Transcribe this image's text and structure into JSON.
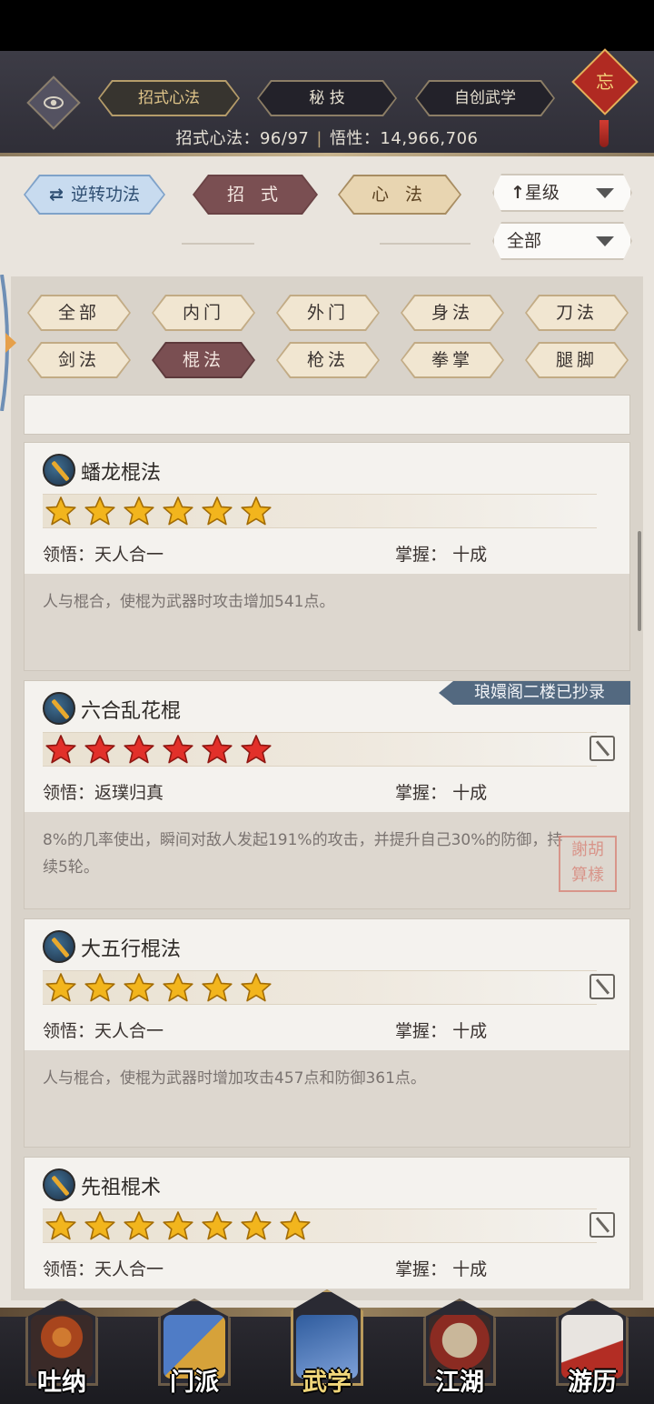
{
  "header": {
    "tabs": [
      {
        "label": "招式心法",
        "active": true
      },
      {
        "label": "秘 技",
        "active": false
      },
      {
        "label": "自创武学",
        "active": false
      }
    ],
    "stats_left": "招式心法：96/97",
    "stats_sep": "|",
    "stats_right": "悟性：14,966,706",
    "knot_char": "忘"
  },
  "toolbar": {
    "reverse_label": "逆转功法",
    "zhaoshi_label": "招 式",
    "xinfa_label": "心 法",
    "sort_label": "星级",
    "filter_label": "全部"
  },
  "categories": [
    {
      "label": "全部",
      "active": false
    },
    {
      "label": "内门",
      "active": false
    },
    {
      "label": "外门",
      "active": false
    },
    {
      "label": "身法",
      "active": false
    },
    {
      "label": "刀法",
      "active": false
    },
    {
      "label": "剑法",
      "active": false
    },
    {
      "label": "棍法",
      "active": true
    },
    {
      "label": "枪法",
      "active": false
    },
    {
      "label": "拳掌",
      "active": false
    },
    {
      "label": "腿脚",
      "active": false
    }
  ],
  "skills": [
    {
      "name": "蟠龙棍法",
      "stars": 6,
      "star_color": "gold",
      "comprehension_label": "领悟：",
      "comprehension": "天人合一",
      "mastery_label": "掌握：",
      "mastery": "十成",
      "description": "人与棍合，使棍为武器时攻击增加541点。"
    },
    {
      "name": "六合乱花棍",
      "stars": 6,
      "star_color": "red",
      "ribbon": "琅嬛阁二楼已抄录",
      "seal": "謝胡 算樣",
      "comprehension_label": "领悟：",
      "comprehension": "返璞归真",
      "mastery_label": "掌握：",
      "mastery": "十成",
      "description": "8%的几率使出，瞬间对敌人发起191%的攻击，并提升自己30%的防御，持续5轮。"
    },
    {
      "name": "大五行棍法",
      "stars": 6,
      "star_color": "gold",
      "comprehension_label": "领悟：",
      "comprehension": "天人合一",
      "mastery_label": "掌握：",
      "mastery": "十成",
      "description": "人与棍合，使棍为武器时增加攻击457点和防御361点。"
    },
    {
      "name": "先祖棍术",
      "stars": 7,
      "star_color": "gold",
      "comprehension_label": "领悟：",
      "comprehension": "天人合一",
      "mastery_label": "掌握：",
      "mastery": "十成",
      "description": ""
    }
  ],
  "bottom_nav": [
    {
      "label": "吐纳",
      "active": false
    },
    {
      "label": "门派",
      "active": false
    },
    {
      "label": "武学",
      "active": true
    },
    {
      "label": "江湖",
      "active": false
    },
    {
      "label": "游历",
      "active": false
    }
  ],
  "colors": {
    "gold_star": "#f2b51d",
    "red_star": "#e2302a",
    "active_tab": "#7a4f52"
  }
}
